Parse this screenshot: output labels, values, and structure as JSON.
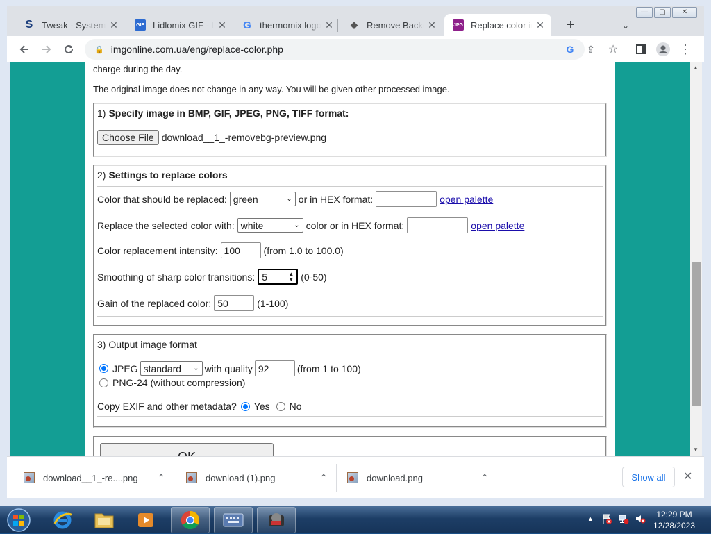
{
  "window_controls": {
    "minimize": "—",
    "maximize": "▢",
    "close": "✕"
  },
  "tabs": [
    {
      "title": "Tweak - System T",
      "icon": "S",
      "icon_color": "#1a3d7c"
    },
    {
      "title": "Lidlomix GIF - Li",
      "icon": "GIF",
      "icon_color": "#2d6bd1"
    },
    {
      "title": "thermomix logo",
      "icon": "G",
      "icon_color": "#4285f4"
    },
    {
      "title": "Remove Backgrou",
      "icon": "◆",
      "icon_color": "#555"
    },
    {
      "title": "Replace color in",
      "icon": "JPG",
      "icon_color": "#8e1f8a"
    }
  ],
  "new_tab": "+",
  "tab_search": "⌄",
  "address": {
    "url": "imgonline.com.ua/eng/replace-color.php"
  },
  "page": {
    "intro_line1": "charge during the day.",
    "intro_line2": "The original image does not change in any way. You will be given other processed image.",
    "section1": {
      "num": "1)",
      "title": "Specify image in BMP, GIF, JPEG, PNG, TIFF format:",
      "choose_file": "Choose File",
      "file_name": "download__1_-removebg-preview.png"
    },
    "section2": {
      "num": "2)",
      "title": "Settings to replace colors",
      "color_replaced_label": "Color that should be replaced:",
      "color_replaced_value": "green",
      "hex_label1": "or in HEX format:",
      "hex_value1": "",
      "open_palette": "open palette",
      "replace_with_label": "Replace the selected color with:",
      "replace_with_value": "white",
      "hex_label2": "color or in HEX format:",
      "hex_value2": "",
      "intensity_label": "Color replacement intensity:",
      "intensity_value": "100",
      "intensity_range": "(from 1.0 to 100.0)",
      "smoothing_label": "Smoothing of sharp color transitions:",
      "smoothing_value": "5",
      "smoothing_range": "(0-50)",
      "gain_label": "Gain of the replaced color:",
      "gain_value": "50",
      "gain_range": "(1-100)"
    },
    "section3": {
      "title": "3) Output image format",
      "jpeg_label": "JPEG",
      "jpeg_mode": "standard",
      "with_quality": "with quality",
      "quality_value": "92",
      "quality_range": "(from 1 to 100)",
      "png_label": "PNG-24 (without compression)",
      "exif_label": "Copy EXIF and other metadata?",
      "yes": "Yes",
      "no": "No"
    },
    "ok_button": "OK"
  },
  "downloads": [
    {
      "name": "download__1_-re....png"
    },
    {
      "name": "download (1).png"
    },
    {
      "name": "download.png"
    }
  ],
  "show_all": "Show all",
  "clock": {
    "time": "12:29 PM",
    "date": "12/28/2023"
  }
}
